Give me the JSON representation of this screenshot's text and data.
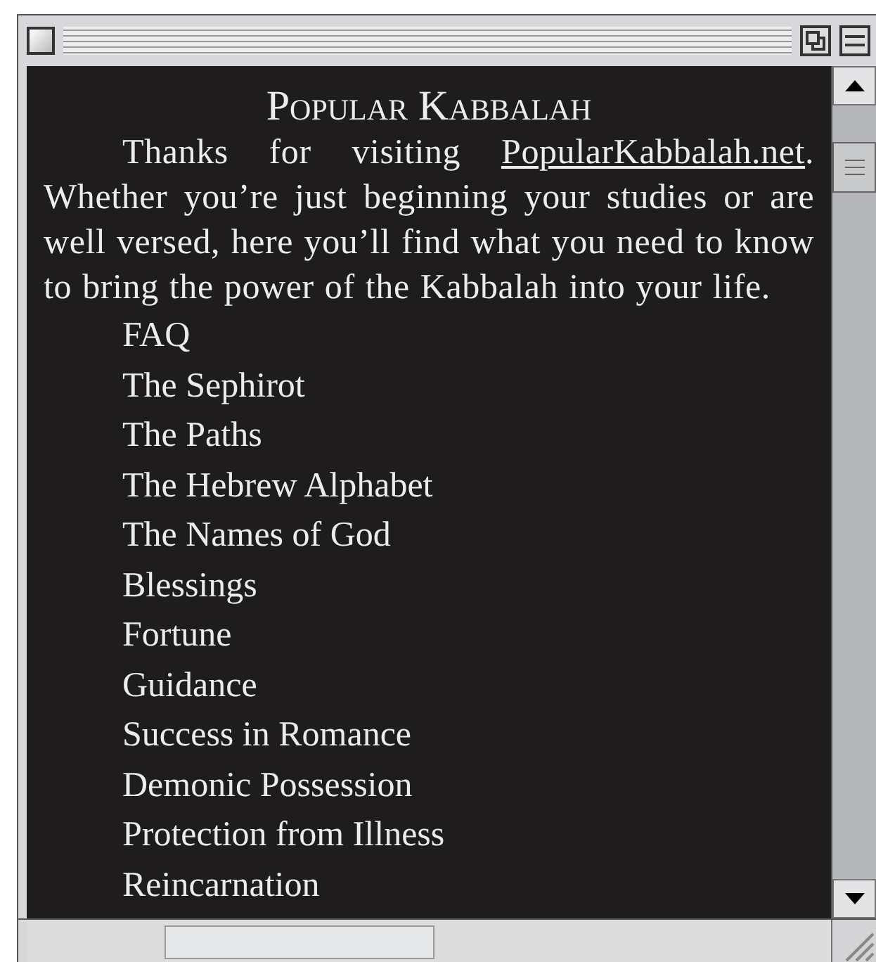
{
  "page": {
    "title": "Popular Kabbalah",
    "intro": {
      "before": "Thanks for visiting ",
      "link": "PopularKabbalah.net",
      "after": ". Whether you’re just beginning your studies or are well versed, here you’ll find what you need to know to bring the power of the Kabbalah into your life."
    },
    "links": [
      "FAQ",
      "The Sephirot",
      "The Paths",
      "The Hebrew Alphabet",
      "The Names of God",
      "Blessings",
      "Fortune",
      "Guidance",
      "Success in Romance",
      "Demonic Possession",
      "Protection from Illness",
      "Reincarnation"
    ]
  }
}
